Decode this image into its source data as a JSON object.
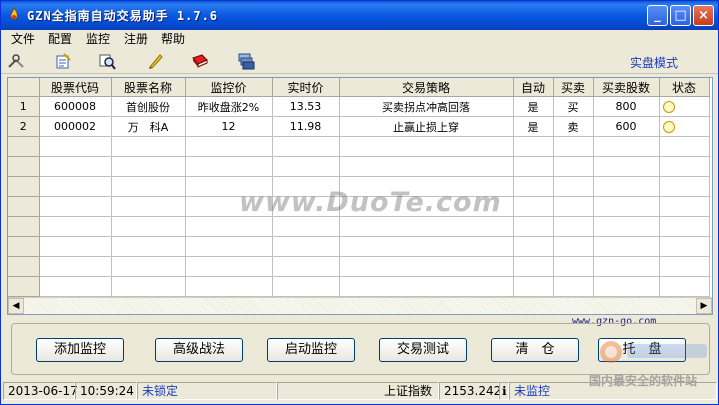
{
  "window": {
    "title": "GZN全指南自动交易助手 1.7.6"
  },
  "menu": [
    "文件",
    "配置",
    "监控",
    "注册",
    "帮助"
  ],
  "toolbar": {
    "icons": [
      "tools-icon",
      "edit-icon",
      "search-icon",
      "pencil-icon",
      "book-icon",
      "stack-icon"
    ],
    "mode_label": "实盘模式"
  },
  "grid": {
    "columns": [
      "股票代码",
      "股票名称",
      "监控价",
      "实时价",
      "交易策略",
      "自动",
      "买卖",
      "买卖股数",
      "状态"
    ],
    "rows": [
      {
        "index": "1",
        "code": "600008",
        "name": "首创股份",
        "monitor_price": "昨收盘涨2%",
        "live_price": "13.53",
        "strategy": "买卖拐点冲高回落",
        "auto": "是",
        "side": "买",
        "shares": "800",
        "status": "alarm-clock-icon"
      },
      {
        "index": "2",
        "code": "000002",
        "name": "万　科A",
        "monitor_price": "12",
        "live_price": "11.98",
        "strategy": "止赢止损上穿",
        "auto": "是",
        "side": "卖",
        "shares": "600",
        "status": "alarm-clock-icon"
      }
    ]
  },
  "website": "www.gzn-go.com",
  "buttons": {
    "add": "添加监控",
    "advanced": "高级战法",
    "start": "启动监控",
    "test": "交易测试",
    "clear": "清　仓",
    "custody": "托　盘"
  },
  "status": {
    "date": "2013-06-17",
    "time": "10:59:24",
    "lock": "未锁定",
    "index_name": "上证指数",
    "index_value": "2153.242",
    "monitor_state": "未监控"
  },
  "watermarks": {
    "main": "www.DuoTe.com",
    "corner": "国内最安全的软件站"
  }
}
